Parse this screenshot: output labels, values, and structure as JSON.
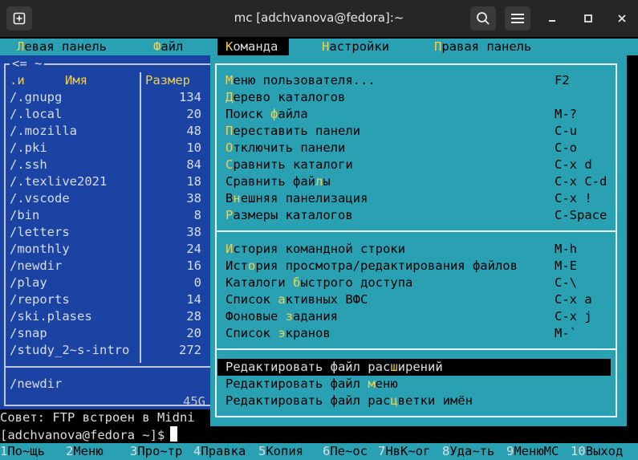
{
  "window": {
    "title": "mc [adchvanova@fedora]:~"
  },
  "menubar": [
    {
      "hot": "Л",
      "rest": "евая панель"
    },
    {
      "hot": "Ф",
      "rest": "айл"
    },
    {
      "hot": "К",
      "rest": "оманда"
    },
    {
      "hot": "Н",
      "rest": "астройки"
    },
    {
      "hot": "П",
      "rest": "равая панель"
    }
  ],
  "left_panel": {
    "path_label": "<= ~",
    "col_name_sort": ".и",
    "col_name": "Имя",
    "col_size": "Размер",
    "files": [
      {
        "name": "/.gnupg",
        "size": "134"
      },
      {
        "name": "/.local",
        "size": "20"
      },
      {
        "name": "/.mozilla",
        "size": "48"
      },
      {
        "name": "/.pki",
        "size": "10"
      },
      {
        "name": "/.ssh",
        "size": "84"
      },
      {
        "name": "/.texlive2021",
        "size": "18"
      },
      {
        "name": "/.vscode",
        "size": "38"
      },
      {
        "name": "/bin",
        "size": "8"
      },
      {
        "name": "/letters",
        "size": "38"
      },
      {
        "name": "/monthly",
        "size": "24"
      },
      {
        "name": "/newdir",
        "size": "16"
      },
      {
        "name": "/play",
        "size": "0"
      },
      {
        "name": "/reports",
        "size": "14"
      },
      {
        "name": "/ski.plases",
        "size": "28"
      },
      {
        "name": "/snap",
        "size": "20"
      },
      {
        "name": "/study_2~s-intro",
        "size": "272"
      }
    ],
    "selected_info": "/newdir",
    "free_space": "45G"
  },
  "command_menu": {
    "groups": [
      [
        {
          "pre": "",
          "hot": "М",
          "post": "еню пользователя...",
          "key": "F2"
        },
        {
          "pre": "",
          "hot": "Д",
          "post": "ерево каталогов",
          "key": ""
        },
        {
          "pre": "Поиск ",
          "hot": "ф",
          "post": "айла",
          "key": "M-?"
        },
        {
          "pre": "",
          "hot": "П",
          "post": "ереставить панели",
          "key": "C-u"
        },
        {
          "pre": "",
          "hot": "О",
          "post": "тключить панели",
          "key": "C-o"
        },
        {
          "pre": "",
          "hot": "С",
          "post": "равнить каталоги",
          "key": "C-x d"
        },
        {
          "pre": "Сравнить фай",
          "hot": "л",
          "post": "ы",
          "key": "C-x C-d"
        },
        {
          "pre": "В",
          "hot": "н",
          "post": "ешняя панелизация",
          "key": "C-x !"
        },
        {
          "pre": "",
          "hot": "Р",
          "post": "азмеры каталогов",
          "key": "C-Space"
        }
      ],
      [
        {
          "pre": "",
          "hot": "И",
          "post": "стория командной строки",
          "key": "M-h"
        },
        {
          "pre": "Ист",
          "hot": "о",
          "post": "рия просмотра/редактирования файлов",
          "key": "M-E"
        },
        {
          "pre": "Каталоги ",
          "hot": "б",
          "post": "ыстрого доступа",
          "key": "C-\\"
        },
        {
          "pre": "Список ",
          "hot": "а",
          "post": "ктивных ВФС",
          "key": "C-x a"
        },
        {
          "pre": "Фоновые ",
          "hot": "з",
          "post": "адания",
          "key": "C-x j"
        },
        {
          "pre": "Список ",
          "hot": "э",
          "post": "кранов",
          "key": "M-`"
        }
      ],
      [
        {
          "pre": "Редактировать файл рас",
          "hot": "ш",
          "post": "ирений",
          "key": "",
          "selected": true
        },
        {
          "pre": "Редактировать файл ",
          "hot": "м",
          "post": "еню",
          "key": ""
        },
        {
          "pre": "Редактировать файл рас",
          "hot": "ц",
          "post": "ветки имён",
          "key": ""
        }
      ]
    ]
  },
  "hint_line": "Совет: FTP встроен в Midni",
  "prompt": "[adchvanova@fedora ~]$",
  "fkeys": [
    {
      "num": "1",
      "label": "По~щь"
    },
    {
      "num": "2",
      "label": "Меню"
    },
    {
      "num": "3",
      "label": "Про~тр"
    },
    {
      "num": "4",
      "label": "Правка"
    },
    {
      "num": "5",
      "label": "Копия"
    },
    {
      "num": "6",
      "label": "Пе~ос"
    },
    {
      "num": "7",
      "label": "НвК~ог"
    },
    {
      "num": "8",
      "label": "Уда~ть"
    },
    {
      "num": "9",
      "label": "МенюMC"
    },
    {
      "num": "10",
      "label": "Выход"
    }
  ],
  "icons": {
    "new_tab": "new-tab-icon",
    "search": "search-icon",
    "menu": "hamburger-icon",
    "minimize": "minimize-icon",
    "maximize": "maximize-icon",
    "close": "close-icon"
  }
}
